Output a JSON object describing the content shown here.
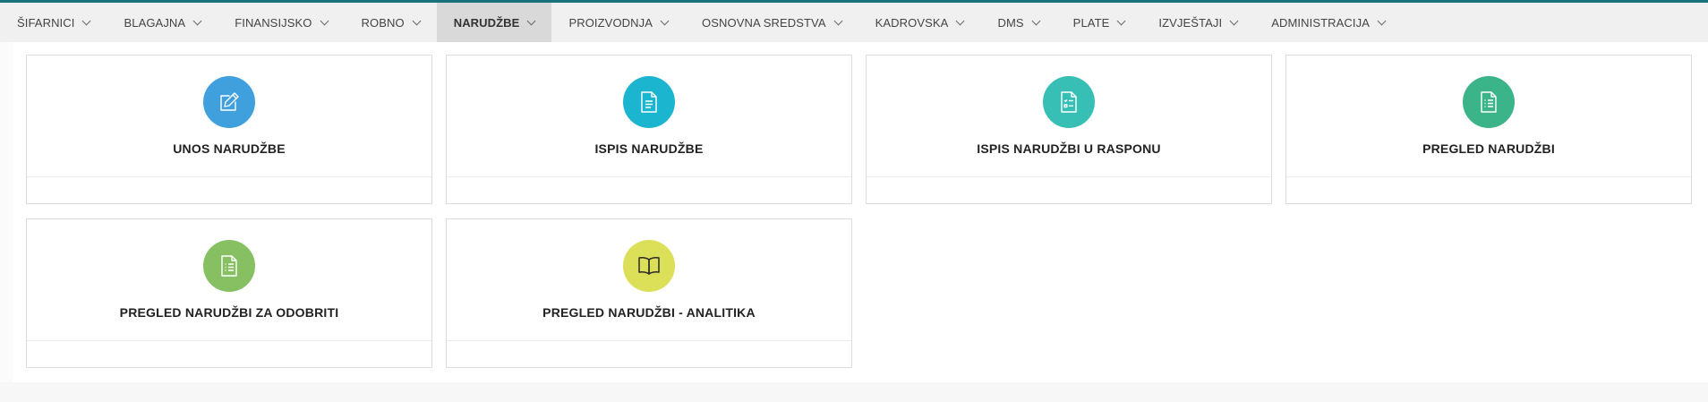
{
  "nav": {
    "items": [
      {
        "label": "ŠIFARNICI"
      },
      {
        "label": "BLAGAJNA"
      },
      {
        "label": "FINANSIJSKO"
      },
      {
        "label": "ROBNO"
      },
      {
        "label": "NARUDŽBE"
      },
      {
        "label": "PROIZVODNJA"
      },
      {
        "label": "OSNOVNA SREDSTVA"
      },
      {
        "label": "KADROVSKA"
      },
      {
        "label": "DMS"
      },
      {
        "label": "PLATE"
      },
      {
        "label": "IZVJEŠTAJI"
      },
      {
        "label": "ADMINISTRACIJA"
      }
    ],
    "active": "NARUDŽBE"
  },
  "cards": [
    {
      "label": "UNOS NARUDŽBE",
      "icon": "edit-icon",
      "color": "#3fa0dd"
    },
    {
      "label": "ISPIS NARUDŽBE",
      "icon": "document-icon",
      "color": "#1cb5cf"
    },
    {
      "label": "ISPIS NARUDŽBI U RASPONU",
      "icon": "checklist-icon",
      "color": "#38bfb5"
    },
    {
      "label": "PREGLED NARUDŽBI",
      "icon": "list-document-icon",
      "color": "#3cb48a"
    },
    {
      "label": "PREGLED NARUDŽBI ZA ODOBRITI",
      "icon": "list-document-icon",
      "color": "#86c062"
    },
    {
      "label": "PREGLED NARUDŽBI - ANALITIKA",
      "icon": "book-icon",
      "color": "#dcdf58"
    }
  ]
}
